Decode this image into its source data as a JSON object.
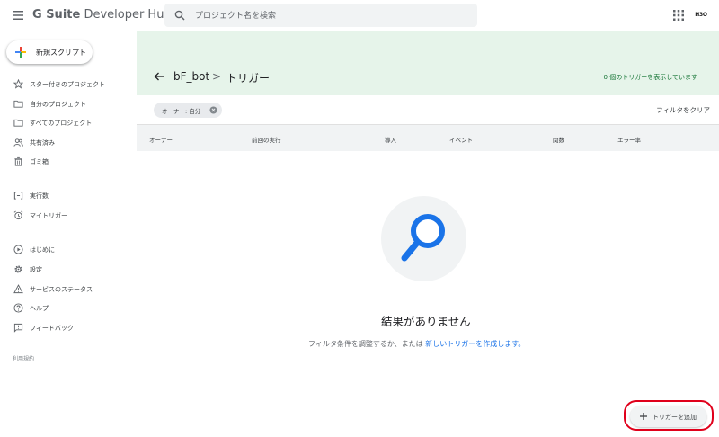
{
  "header": {
    "logo_prefix": "G Suite",
    "logo_suffix": " Developer Hub",
    "search_placeholder": "プロジェクト名を検索",
    "avatar_text": "H3O"
  },
  "sidebar": {
    "new_script_label": "新規スクリプト",
    "items": [
      {
        "label": "スター付きのプロジェクト",
        "icon": "star-icon"
      },
      {
        "label": "自分のプロジェクト",
        "icon": "folder-icon"
      },
      {
        "label": "すべてのプロジェクト",
        "icon": "folder-icon"
      },
      {
        "label": "共有済み",
        "icon": "people-icon"
      },
      {
        "label": "ゴミ箱",
        "icon": "trash-icon"
      },
      {
        "label": "実行数",
        "icon": "executions-icon"
      },
      {
        "label": "マイトリガー",
        "icon": "alarm-icon"
      },
      {
        "label": "はじめに",
        "icon": "play-icon"
      },
      {
        "label": "設定",
        "icon": "gear-icon"
      },
      {
        "label": "サービスのステータス",
        "icon": "warning-icon"
      },
      {
        "label": "ヘルプ",
        "icon": "help-icon"
      },
      {
        "label": "フィードバック",
        "icon": "feedback-icon"
      }
    ],
    "terms_label": "利用規約"
  },
  "main": {
    "breadcrumb": {
      "project": "bF_bot",
      "separator": ">",
      "current": "トリガー"
    },
    "trigger_count_text": "0 個のトリガーを表示しています",
    "filter_chip": "オーナー: 自分",
    "clear_filter": "フィルタをクリア",
    "columns": [
      "オーナー",
      "前回の実行",
      "導入",
      "イベント",
      "関数",
      "エラー率"
    ],
    "empty": {
      "title": "結果がありません",
      "message": "フィルタ条件を調整するか、または ",
      "link": "新しいトリガーを作成します。"
    },
    "add_trigger_label": "トリガーを追加"
  },
  "colors": {
    "banner_bg": "#e6f4ea",
    "count_text": "#137333",
    "link": "#1a73e8",
    "search_icon": "#1a73e8",
    "highlight_ring": "#e0001b"
  }
}
